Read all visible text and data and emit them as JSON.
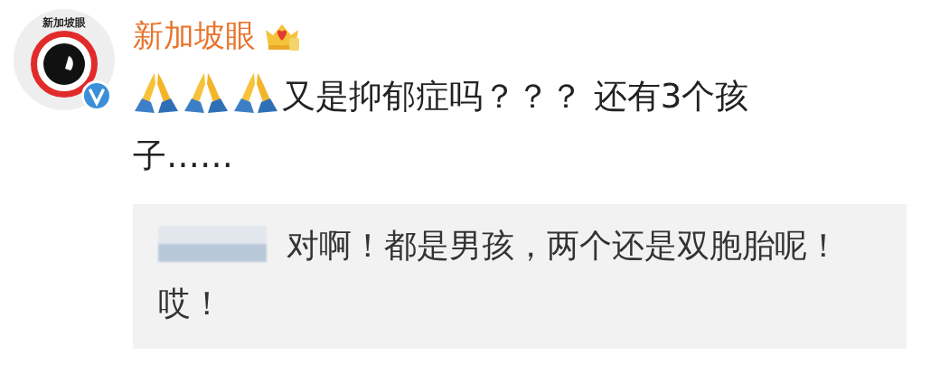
{
  "author": {
    "avatar_text": "新加坡眼",
    "verified": true,
    "name": "新加坡眼",
    "member_crown": true
  },
  "comment": {
    "emojis": [
      {
        "kind": "folded-hands"
      },
      {
        "kind": "folded-hands"
      },
      {
        "kind": "folded-hands"
      }
    ],
    "text": "又是抑郁症吗？？？ 还有3个孩子……"
  },
  "reply": {
    "author_hidden": true,
    "text": "对啊！都是男孩，两个还是双胞胎呢！哎！"
  }
}
